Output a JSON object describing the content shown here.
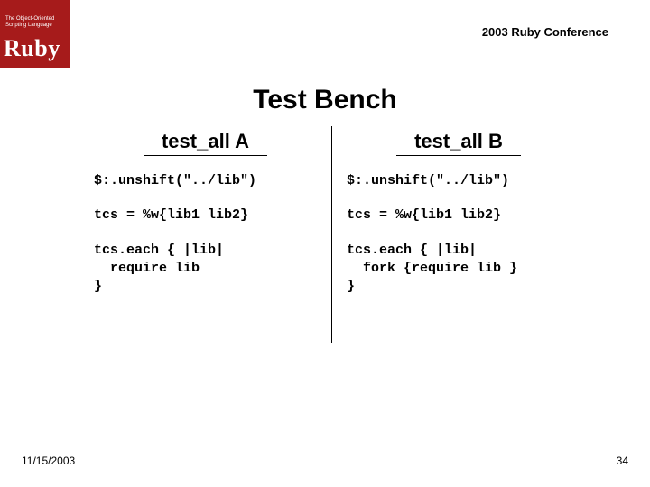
{
  "header": {
    "logo_tagline": "The Object-Oriented Scripting Language",
    "logo_name": "Ruby",
    "conference": "2003 Ruby Conference"
  },
  "title": "Test Bench",
  "columns": {
    "a": {
      "heading": "test_all A",
      "line1": "$:.unshift(\"../lib\")",
      "line2": "tcs = %w{lib1 lib2}",
      "line3": "tcs.each { |lib|\n  require lib\n}"
    },
    "b": {
      "heading": "test_all B",
      "line1": "$:.unshift(\"../lib\")",
      "line2": "tcs = %w{lib1 lib2}",
      "line3": "tcs.each { |lib|\n  fork {require lib }\n}"
    }
  },
  "footer": {
    "date": "11/15/2003",
    "page": "34"
  }
}
